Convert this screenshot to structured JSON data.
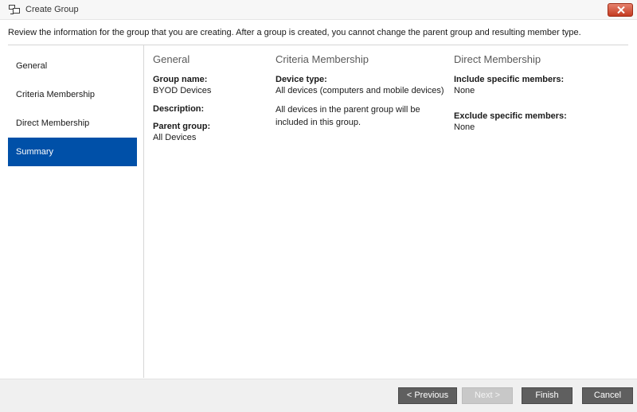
{
  "window": {
    "title": "Create Group",
    "app_icon": "group-devices-icon",
    "close_icon": "close-icon",
    "close_color": "#d0472c"
  },
  "instructions": "Review the information for the group that you are creating. After a group is created, you cannot change the parent group and resulting member type.",
  "nav": {
    "items": [
      "General",
      "Criteria Membership",
      "Direct Membership",
      "Summary"
    ],
    "active": "Summary",
    "active_color": "#0050a8"
  },
  "summary": {
    "general": {
      "heading": "General",
      "group_name_label": "Group name:",
      "group_name_value": "BYOD Devices",
      "description_label": "Description:",
      "description_value": "",
      "parent_group_label": "Parent group:",
      "parent_group_value": "All Devices"
    },
    "criteria": {
      "heading": "Criteria Membership",
      "device_type_label": "Device type:",
      "device_type_value": "All devices (computers and mobile devices)",
      "note_line1": "All devices in the parent group will be",
      "note_line2": "included in this group."
    },
    "direct": {
      "heading": "Direct Membership",
      "include_label": "Include specific members:",
      "include_value": "None",
      "exclude_label": "Exclude specific members:",
      "exclude_value": "None"
    }
  },
  "footer": {
    "previous": "< Previous",
    "next": "Next >",
    "finish": "Finish",
    "cancel": "Cancel"
  }
}
